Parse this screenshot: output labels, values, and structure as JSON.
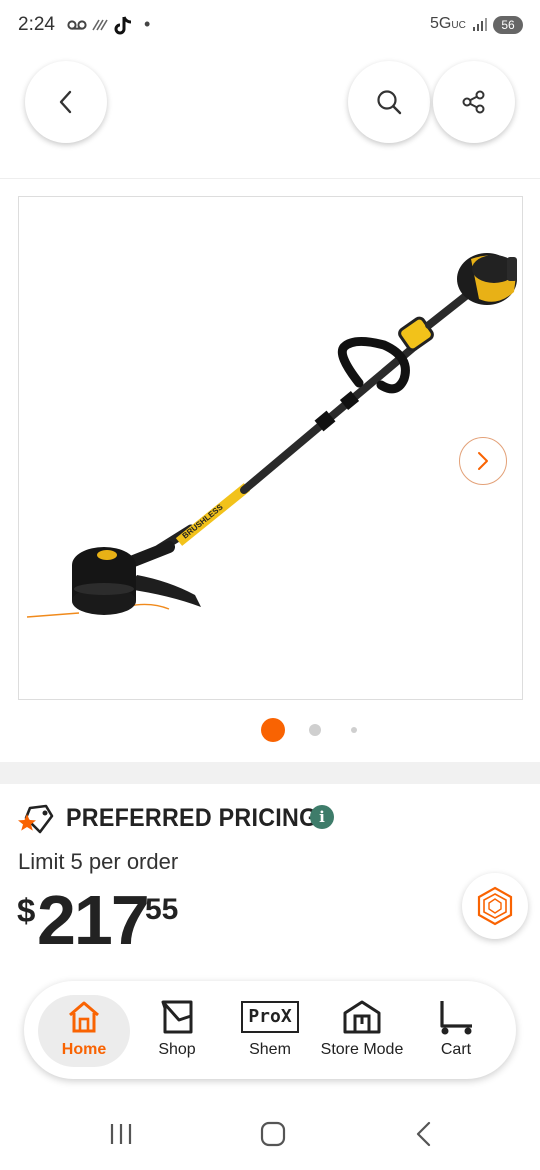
{
  "status_bar": {
    "time": "2:24",
    "voicemail_icon": "voicemail-icon",
    "wifi_call_icon": "wifi-call-icon",
    "tiktok_icon": "tiktok-icon",
    "dot": "•",
    "network": "5G",
    "network_sub": "UC",
    "battery": "56"
  },
  "header": {
    "back_icon": "chevron-left-icon",
    "search_icon": "search-icon",
    "share_icon": "share-icon"
  },
  "gallery": {
    "product_image": "string-trimmer-product-image",
    "next_icon": "chevron-right-icon",
    "total_images": 3,
    "active_index": 0,
    "brand_text": "BRUSHLESS"
  },
  "pricing": {
    "label": "PREFERRED PRICING",
    "info_icon": "i",
    "limit": "Limit 5 per order",
    "currency": "$",
    "dollars": "217",
    "cents": "55"
  },
  "bottom_nav": {
    "items": [
      {
        "label": "Home",
        "icon": "home-icon",
        "active": true
      },
      {
        "label": "Shop",
        "icon": "shop-icon",
        "active": false
      },
      {
        "label": "Shem",
        "icon": "prox-icon",
        "active": false
      },
      {
        "label": "Store Mode",
        "icon": "store-icon",
        "active": false
      },
      {
        "label": "Cart",
        "icon": "cart-icon",
        "active": false
      }
    ],
    "prox_badge": "ProX"
  },
  "colors": {
    "brand_orange": "#f96302",
    "info_green": "#3e7c6a"
  }
}
